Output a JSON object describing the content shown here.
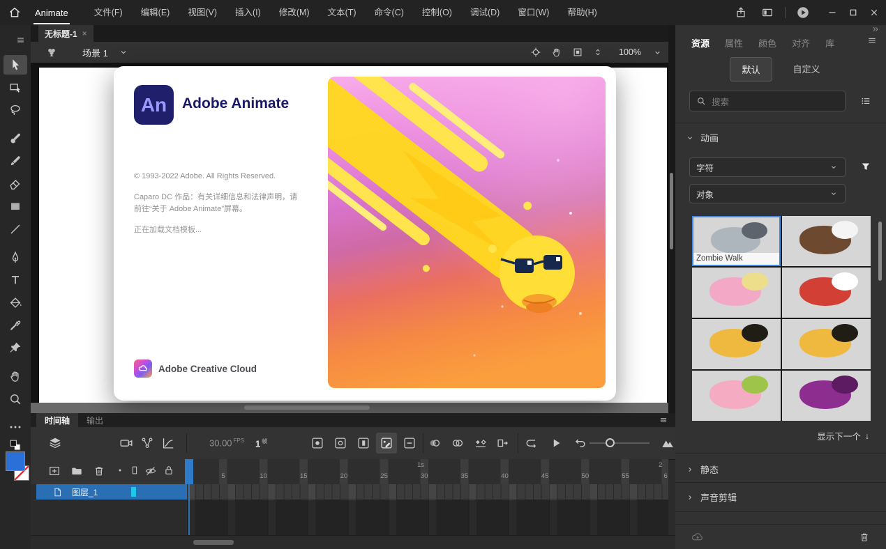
{
  "titlebar": {
    "app_label": "Animate",
    "menus": [
      "文件(F)",
      "编辑(E)",
      "视图(V)",
      "插入(I)",
      "修改(M)",
      "文本(T)",
      "命令(C)",
      "控制(O)",
      "调试(D)",
      "窗口(W)",
      "帮助(H)"
    ]
  },
  "tabs": {
    "document_title": "无标题-1",
    "close_glyph": "×"
  },
  "edit_bar": {
    "scene_label": "场景 1",
    "zoom_value": "100%"
  },
  "splash": {
    "logo_text": "An",
    "title": "Adobe Animate",
    "copyright": "© 1993-2022 Adobe. All Rights Reserved.",
    "credits_line1": "Caparo DC 作品：有关详细信息和法律声明，请",
    "credits_line2": "前往“关于 Adobe Animate”屏幕。",
    "status": "正在加载文档模板...",
    "footer": "Adobe Creative Cloud"
  },
  "assets_panel": {
    "tabs": [
      {
        "label": "资源",
        "selected": true
      },
      {
        "label": "属性"
      },
      {
        "label": "颜色"
      },
      {
        "label": "对齐"
      },
      {
        "label": "库"
      }
    ],
    "mode_tabs": [
      {
        "label": "默认",
        "selected": true
      },
      {
        "label": "自定义"
      }
    ],
    "search_placeholder": "搜索",
    "animation_section": "动画",
    "filter_1": "字符",
    "filter_2": "对象",
    "thumbnails": [
      {
        "name": "zombie-walk",
        "label": "Zombie Walk",
        "selected": true,
        "c1": "#aeb6bd",
        "c2": "#5d646d"
      },
      {
        "name": "wolf-run",
        "c1": "#6d4a2f",
        "c2": "#f4f4f4"
      },
      {
        "name": "snail",
        "c1": "#f3a9c6",
        "c2": "#ecde8a"
      },
      {
        "name": "santa",
        "c1": "#d23f35",
        "c2": "#ffffff"
      },
      {
        "name": "dog-run",
        "c1": "#efb93f",
        "c2": "#201d15"
      },
      {
        "name": "dog-sit",
        "c1": "#efb93f",
        "c2": "#201d15"
      },
      {
        "name": "pig-parachute",
        "c1": "#f5abc2",
        "c2": "#9fc44a"
      },
      {
        "name": "ninja",
        "c1": "#8e2d90",
        "c2": "#5d1b61"
      }
    ],
    "show_next_label": "显示下一个",
    "show_next_arrow": "↓",
    "static_section": "静态",
    "sound_section": "声音剪辑"
  },
  "timeline": {
    "tabs": [
      {
        "label": "时间轴",
        "selected": true
      },
      {
        "label": "输出"
      }
    ],
    "fps_value": "30.00",
    "fps_unit": "FPS",
    "frame_value": "1",
    "frame_unit": "帧",
    "layer_name": "图层_1",
    "ruler_frames": [
      "5",
      "10",
      "15",
      "20",
      "25",
      "30",
      "35",
      "40",
      "45",
      "50",
      "55",
      "6"
    ],
    "second_1": "1s",
    "second_2": "2"
  },
  "colors": {
    "selection_blue": "#2a6eb4",
    "playhead_blue": "#2e7bc9",
    "layer_cyan": "#1fc8e8",
    "fill_swatch": "#2b6fd9",
    "thumbnail_selected_border": "#3f8ae0"
  }
}
